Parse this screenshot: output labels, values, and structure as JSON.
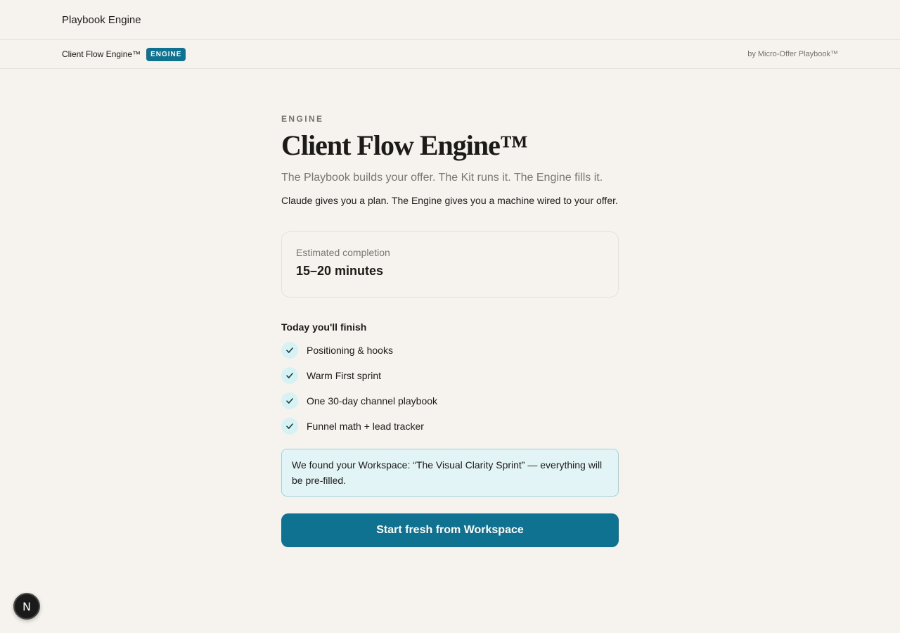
{
  "header": {
    "brand": "Playbook Engine"
  },
  "subheader": {
    "title": "Client Flow Engine™",
    "badge": "ENGINE",
    "byline": "by Micro-Offer Playbook™"
  },
  "main": {
    "eyebrow": "ENGINE",
    "title": "Client Flow Engine™",
    "tagline": "The Playbook builds your offer. The Kit runs it. The Engine fills it.",
    "description": "Claude gives you a plan. The Engine gives you a machine wired to your offer.",
    "estimate": {
      "label": "Estimated completion",
      "value": "15–20 minutes"
    },
    "finish_title": "Today you'll finish",
    "checklist": [
      "Positioning & hooks",
      "Warm First sprint",
      "One 30-day channel playbook",
      "Funnel math + lead tracker"
    ],
    "notice": "We found your Workspace: “The Visual Clarity Sprint” — everything will be pre-filled.",
    "cta_label": "Start fresh from Workspace"
  },
  "dev_badge": {
    "letter": "N",
    "icon": "nextjs-icon"
  },
  "colors": {
    "accent": "#0f7290",
    "background": "#f6f3ee",
    "check_bg": "#d6f2f3",
    "notice_bg": "#e2f4f5"
  }
}
